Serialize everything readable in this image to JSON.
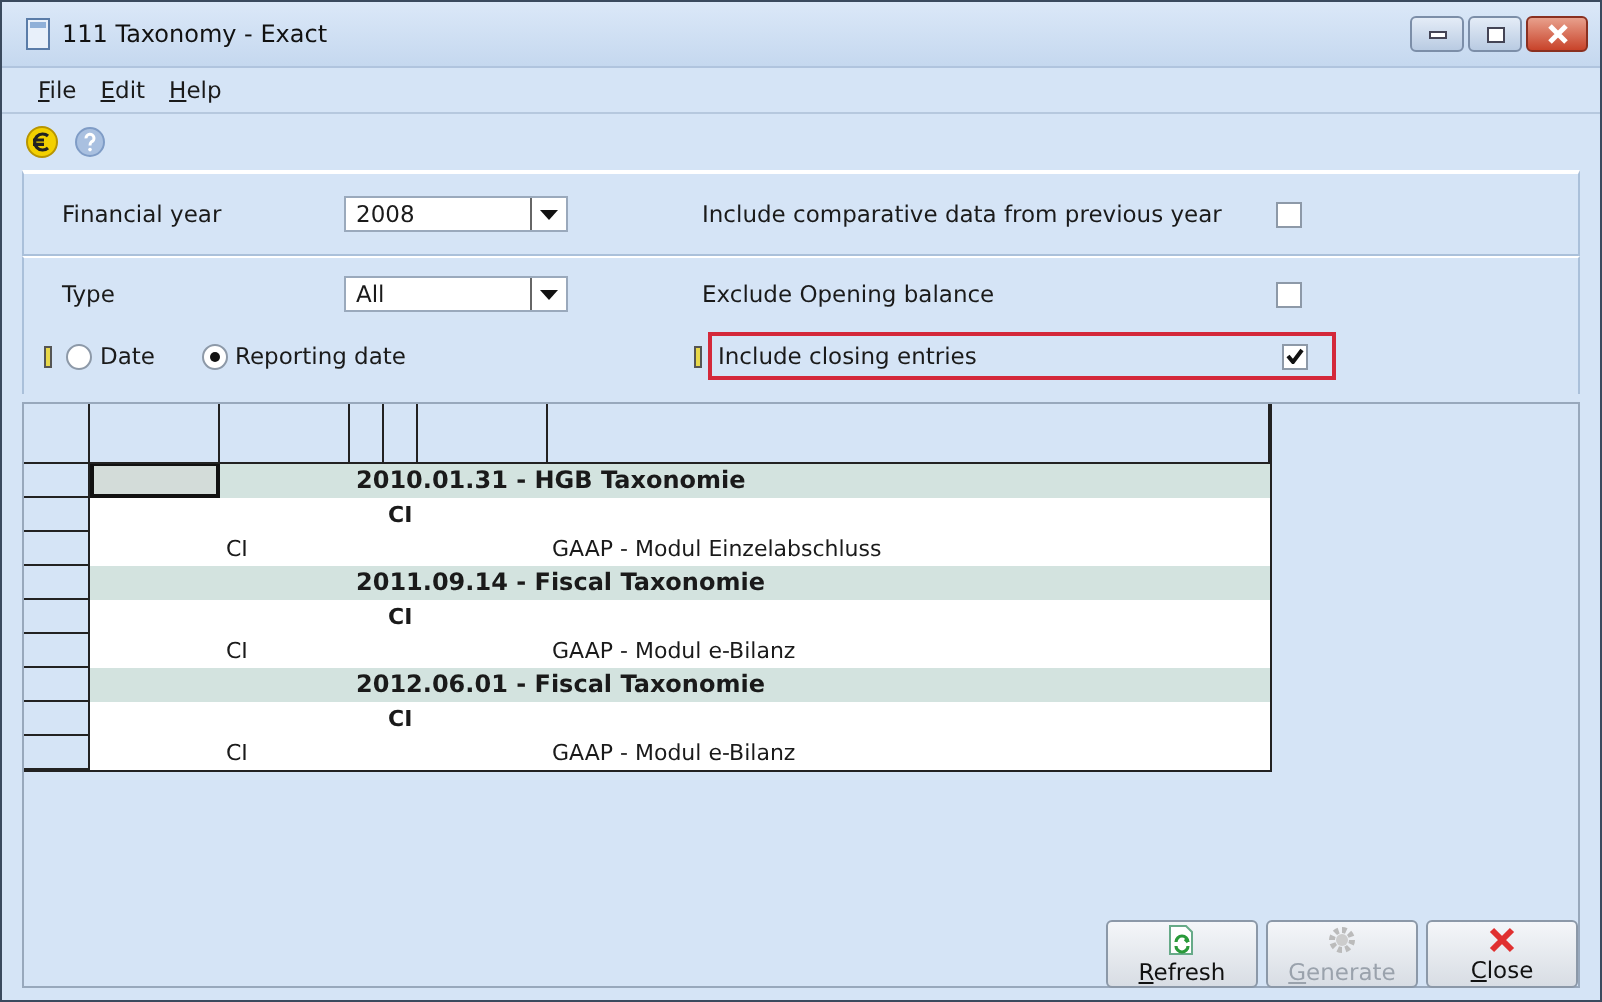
{
  "window": {
    "title": "111 Taxonomy - Exact"
  },
  "menu": [
    {
      "label": "File"
    },
    {
      "label": "Edit"
    },
    {
      "label": "Help"
    }
  ],
  "filters": {
    "financial_year": {
      "label": "Financial year",
      "value": "2008"
    },
    "type": {
      "label": "Type",
      "value": "All"
    },
    "date_mode": [
      {
        "label": "Date",
        "selected": false
      },
      {
        "label": "Reporting date",
        "selected": true
      }
    ]
  },
  "options": [
    {
      "label": "Include comparative data from previous year",
      "checked": false
    },
    {
      "label": "Exclude Opening balance",
      "checked": false
    },
    {
      "label": "Include closing entries",
      "checked": true,
      "highlighted": true
    }
  ],
  "table": {
    "rows": [
      {
        "kind": "group",
        "title": "2010.01.31 - HGB Taxonomie",
        "focused": true
      },
      {
        "kind": "sub",
        "code": "CI",
        "focused": false
      },
      {
        "kind": "detail",
        "code": "CI",
        "description": "GAAP - Modul Einzelabschluss",
        "focused": false
      },
      {
        "kind": "group",
        "title": "2011.09.14 - Fiscal Taxonomie",
        "focused": false
      },
      {
        "kind": "sub",
        "code": "CI",
        "focused": false
      },
      {
        "kind": "detail",
        "code": "CI",
        "description": "GAAP - Modul e-Bilanz",
        "focused": false
      },
      {
        "kind": "group",
        "title": "2012.06.01 - Fiscal Taxonomie",
        "focused": false
      },
      {
        "kind": "sub",
        "code": "CI",
        "focused": false
      },
      {
        "kind": "detail",
        "code": "CI",
        "description": "GAAP - Modul e-Bilanz",
        "focused": false
      }
    ]
  },
  "buttons": [
    {
      "label": "Refresh",
      "kind": "refresh",
      "disabled": false
    },
    {
      "label": "Generate",
      "kind": "generate",
      "disabled": true
    },
    {
      "label": "Close",
      "kind": "close",
      "disabled": false
    }
  ]
}
